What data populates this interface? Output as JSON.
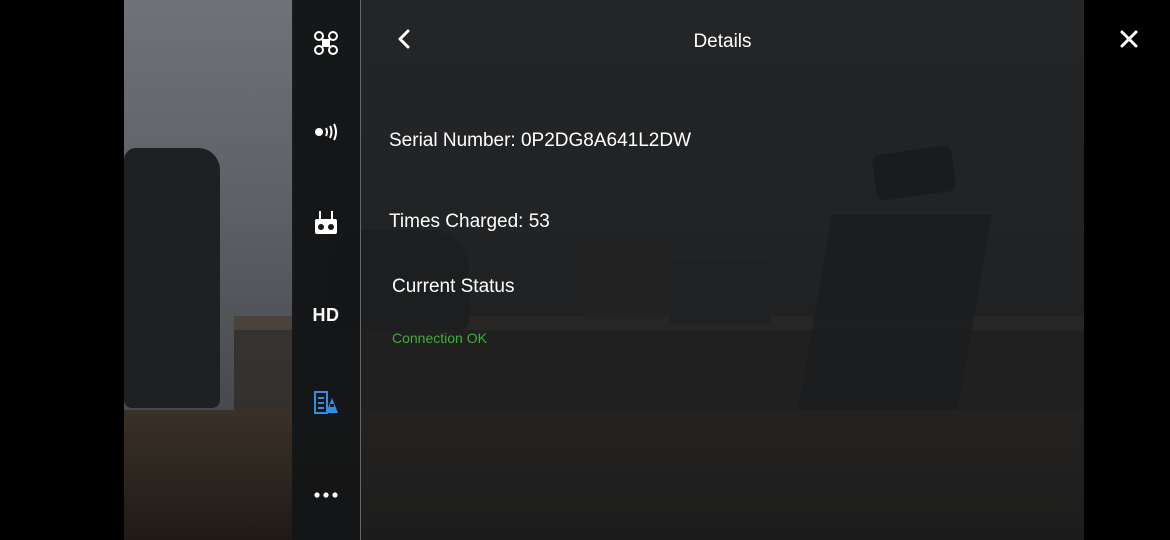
{
  "header": {
    "title": "Details"
  },
  "sidebar": {
    "items": [
      {
        "icon": "drone-icon"
      },
      {
        "icon": "signal-icon"
      },
      {
        "icon": "remote-controller-icon"
      },
      {
        "label": "HD"
      },
      {
        "icon": "battery-info-icon",
        "color": "#2f8fe8"
      },
      {
        "icon": "more-icon"
      }
    ]
  },
  "details": {
    "serial_label": "Serial Number: 0P2DG8A641L2DW",
    "times_charged_label": "Times Charged: 53",
    "current_status_label": "Current Status",
    "status_value": "Connection OK",
    "status_color": "#3fae3a"
  }
}
